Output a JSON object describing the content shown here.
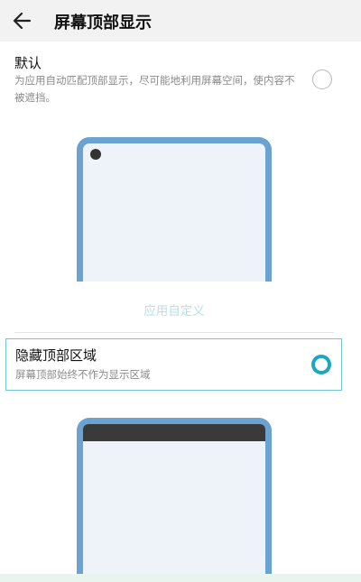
{
  "header": {
    "title": "屏幕顶部显示"
  },
  "options": [
    {
      "title": "默认",
      "description": "为应用自动匹配顶部显示，尽可能地利用屏幕空间，使内容不被遮挡。",
      "selected": false
    },
    {
      "title": "隐藏顶部区域",
      "description": "屏幕顶部始终不作为显示区域",
      "selected": true
    }
  ],
  "custom_link": "应用自定义",
  "colors": {
    "accent": "#19a8c4",
    "phone_frame": "#6aa2d2",
    "phone_screen": "#eef3fa",
    "hidden_bar": "#3a3a3a"
  },
  "icons": {
    "back": "arrow-left-icon"
  }
}
